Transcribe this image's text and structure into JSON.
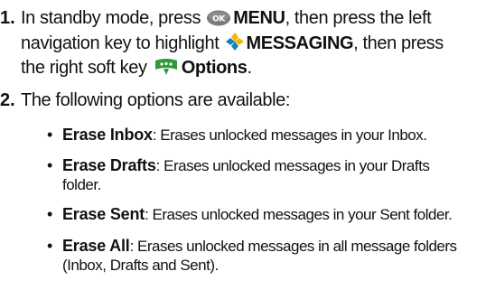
{
  "steps": [
    {
      "number": "1.",
      "line1_pre": "In standby mode, press",
      "menu_key_label": "OK",
      "menu_label": "MENU",
      "line1_post": ", then press the left",
      "line2_pre": "navigation key to highlight",
      "messaging_label": "MESSAGING",
      "line2_post": ", then press",
      "line3_pre": "the right soft key",
      "options_label": "Options",
      "line3_post": "."
    },
    {
      "number": "2.",
      "text": "The following options are available:"
    }
  ],
  "options": [
    {
      "bullet": "•",
      "term": "Erase Inbox",
      "line1": ": Erases unlocked messages in your Inbox.",
      "line2": ""
    },
    {
      "bullet": "•",
      "term": "Erase Drafts",
      "line1": ": Erases unlocked messages in your Drafts",
      "line2": "folder."
    },
    {
      "bullet": "•",
      "term": "Erase Sent",
      "line1": ": Erases unlocked messages in your Sent folder.",
      "line2": ""
    },
    {
      "bullet": "•",
      "term": "Erase All",
      "line1": ":  Erases unlocked messages in all message folders",
      "line2": "(Inbox, Drafts and Sent)."
    }
  ],
  "colors": {
    "ok_key": "#7a7a7a",
    "messaging_icon_yellow": "#f2b705",
    "messaging_icon_blue": "#1a7fc1",
    "options_icon": "#2f9a3a"
  }
}
